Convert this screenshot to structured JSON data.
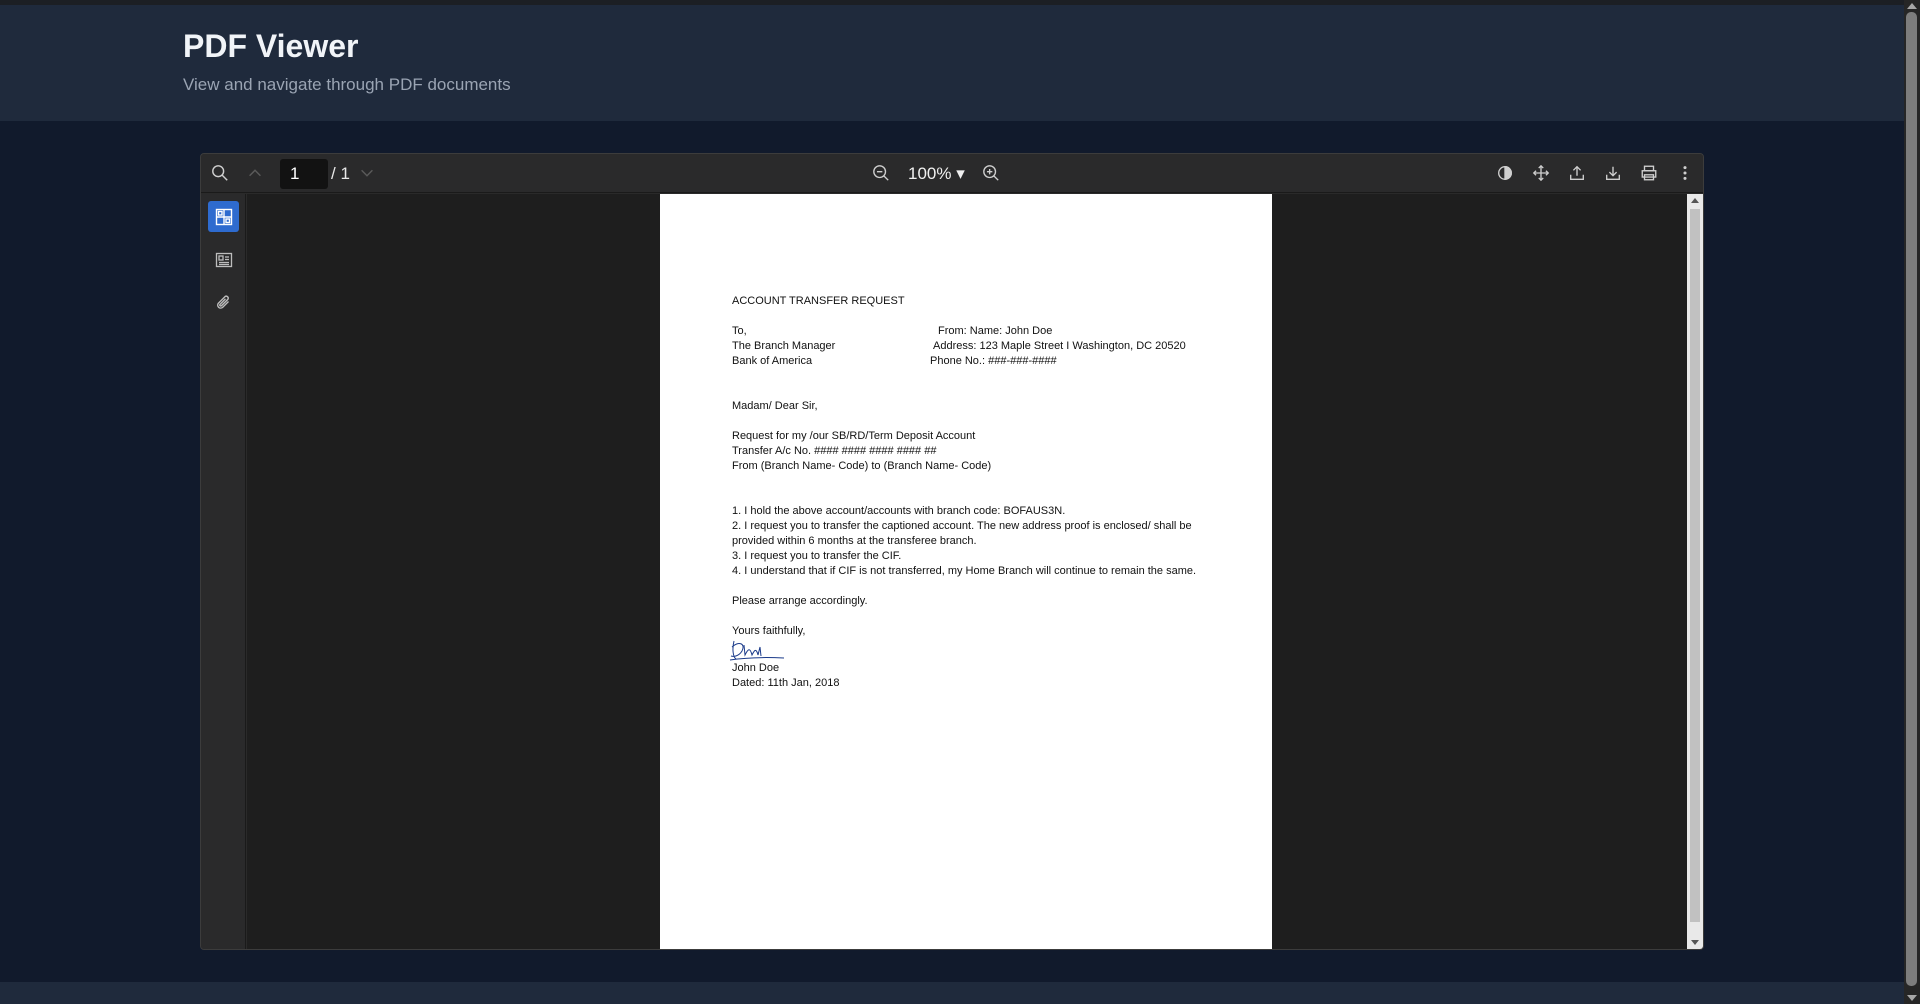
{
  "app": {
    "title": "PDF Viewer",
    "subtitle": "View and navigate through PDF documents"
  },
  "toolbar": {
    "current_page": "1",
    "total_pages": "/ 1",
    "zoom": "100% ▾",
    "icons": {
      "search": "search-icon",
      "prev": "chevron-up-icon",
      "next": "chevron-down-icon",
      "zoom_out": "zoom-out-icon",
      "zoom_in": "zoom-in-icon",
      "theme": "theme-toggle-icon",
      "pan": "move-icon",
      "open": "upload-icon",
      "download": "download-icon",
      "print": "print-icon",
      "more": "more-vertical-icon"
    }
  },
  "sidebar": {
    "items": [
      {
        "name": "thumbnails",
        "icon": "thumbnails-icon",
        "active": true
      },
      {
        "name": "outline",
        "icon": "outline-icon",
        "active": false
      },
      {
        "name": "attachments",
        "icon": "paperclip-icon",
        "active": false
      }
    ]
  },
  "document": {
    "heading": "ACCOUNT TRANSFER REQUEST",
    "to_label": "To,",
    "from_name": "From: Name: John Doe",
    "recipient_line1": "The Branch Manager",
    "address": "Address: 123 Maple Street I Washington, DC 20520",
    "recipient_line2": "Bank of America",
    "phone": "Phone No.: ###-###-####",
    "salutation": "Madam/ Dear Sir,",
    "request_line1": "Request for my /our SB/RD/Term Deposit Account",
    "request_line2": "Transfer A/c No. #### #### #### #### ##",
    "request_line3": "From (Branch Name- Code) to (Branch Name- Code)",
    "point1": "1. I hold the above account/accounts with branch code: BOFAUS3N.",
    "point2a": "2. I request you to transfer the captioned account. The new address proof is enclosed/ shall be",
    "point2b": "provided within 6 months at the transferee branch.",
    "point3": "3. I request you to transfer the CIF.",
    "point4": "4. I understand that if CIF is not transferred, my Home Branch will continue to remain the same.",
    "arrange": "Please arrange accordingly.",
    "closing": "Yours faithfully,",
    "signer": "John Doe",
    "dated": "Dated: 11th Jan, 2018"
  },
  "colors": {
    "background": "#111a2c",
    "header": "#1f2a3c",
    "accent": "#2e6bcf",
    "viewer": "#2a2a2a"
  }
}
